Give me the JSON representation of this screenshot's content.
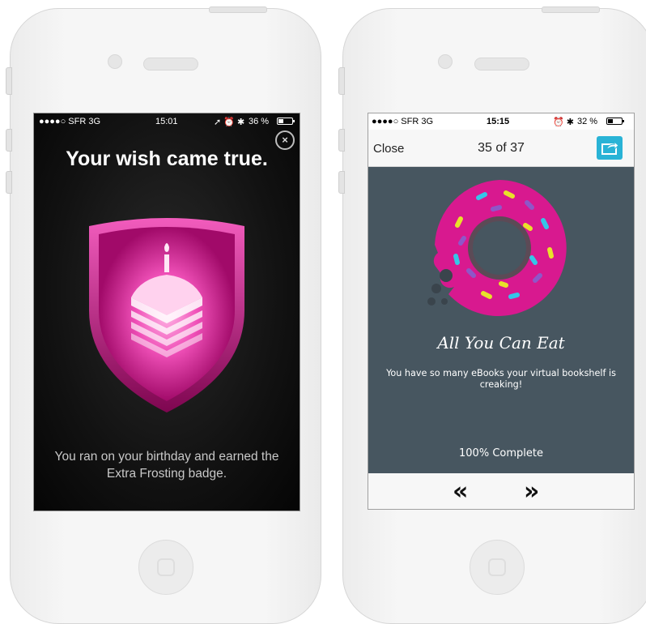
{
  "left_phone": {
    "status": {
      "carrier": "●●●●○ SFR  3G",
      "time": "15:01",
      "icons": "➚ ⏰ ✱",
      "battery": "36 %",
      "battery_level": 0.36
    },
    "title": "Your wish came true.",
    "close_icon": "×",
    "badge": {
      "icon": "cake-slice-candle-icon",
      "shield_color": "#d3168e"
    },
    "message": "You ran on your birthday and earned the Extra Frosting badge."
  },
  "right_phone": {
    "status": {
      "carrier": "●●●●○ SFR  3G",
      "time": "15:15",
      "icons": "⏰ ✱",
      "battery": "32 %",
      "battery_level": 0.32
    },
    "nav": {
      "close_label": "Close",
      "page_count": "35 of 37",
      "share_icon": "share-icon"
    },
    "achievement": {
      "icon": "donut-icon",
      "title": "All You Can Eat",
      "description": "You have so many eBooks your virtual bookshelf is creaking!",
      "progress": "100% Complete"
    },
    "pager": {
      "prev_label": "«",
      "next_label": "»"
    },
    "colors": {
      "content_bg": "#475660",
      "accent": "#29b3d6",
      "donut": "#d8198f"
    }
  }
}
